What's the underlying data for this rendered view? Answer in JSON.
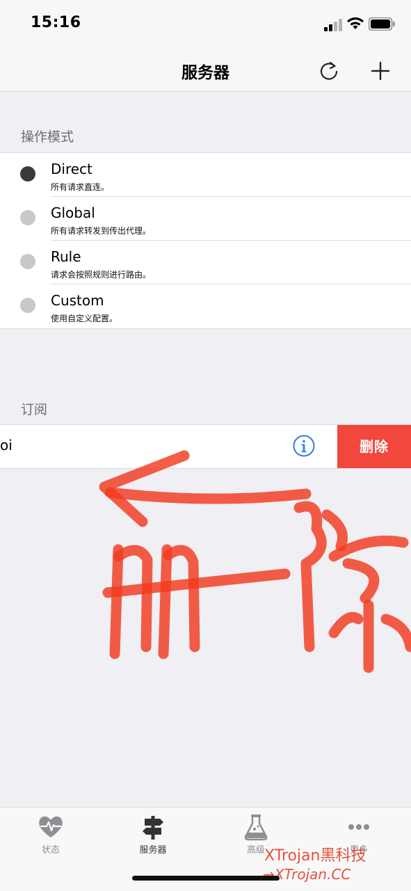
{
  "status_bar": {
    "time": "15:16"
  },
  "nav": {
    "title": "服务器",
    "refresh_icon": "refresh-icon",
    "add_icon": "plus-icon"
  },
  "mode_section": {
    "header": "操作模式",
    "modes": [
      {
        "title": "Direct",
        "subtitle": "所有请求直连。",
        "selected": true
      },
      {
        "title": "Global",
        "subtitle": "所有请求转发到传出代理。",
        "selected": false
      },
      {
        "title": "Rule",
        "subtitle": "请求会按照规则进行路由。",
        "selected": false
      },
      {
        "title": "Custom",
        "subtitle": "使用自定义配置。",
        "selected": false
      }
    ]
  },
  "subscription_section": {
    "header": "订阅",
    "row": {
      "name": "oi",
      "info_icon": "info-icon",
      "delete_label": "删除"
    }
  },
  "tab_bar": {
    "tabs": [
      {
        "label": "状态",
        "icon": "heart-pulse-icon",
        "active": false
      },
      {
        "label": "服务器",
        "icon": "signpost-icon",
        "active": true
      },
      {
        "label": "高级",
        "icon": "flask-icon",
        "active": false
      },
      {
        "label": "更多",
        "icon": "more-dots-icon",
        "active": false
      }
    ]
  },
  "watermark": {
    "line1": "XTrojan黑科技",
    "line2": "→XTrojan.CC"
  },
  "colors": {
    "delete": "#f2473d",
    "info": "#2f7fd6",
    "scribble": "#f23a1f"
  }
}
